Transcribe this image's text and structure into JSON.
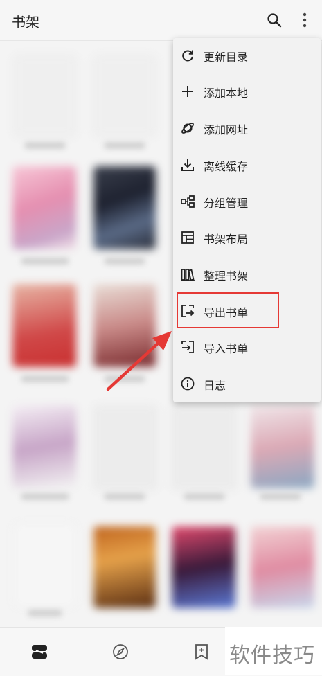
{
  "appbar": {
    "title": "书架",
    "search_icon": "search-icon",
    "more_icon": "more-vertical-icon"
  },
  "menu": {
    "items": [
      {
        "label": "更新目录",
        "icon": "refresh-icon"
      },
      {
        "label": "添加本地",
        "icon": "plus-icon"
      },
      {
        "label": "添加网址",
        "icon": "planet-icon"
      },
      {
        "label": "离线缓存",
        "icon": "download-icon"
      },
      {
        "label": "分组管理",
        "icon": "group-icon"
      },
      {
        "label": "书架布局",
        "icon": "layout-icon"
      },
      {
        "label": "整理书架",
        "icon": "books-icon"
      },
      {
        "label": "导出书单",
        "icon": "export-icon"
      },
      {
        "label": "导入书单",
        "icon": "import-icon"
      },
      {
        "label": "日志",
        "icon": "info-icon"
      }
    ],
    "highlighted": "导出书单"
  },
  "bottom_nav": {
    "items": [
      {
        "icon": "bookshelf-icon",
        "active": true
      },
      {
        "icon": "compass-icon",
        "active": false
      },
      {
        "icon": "bookmark-add-icon",
        "active": false
      }
    ]
  },
  "watermark": "软件技巧",
  "colors": {
    "highlight": "#e53935",
    "arrow": "#e53935",
    "menu_bg": "#f2f2f2",
    "text": "#222222"
  }
}
